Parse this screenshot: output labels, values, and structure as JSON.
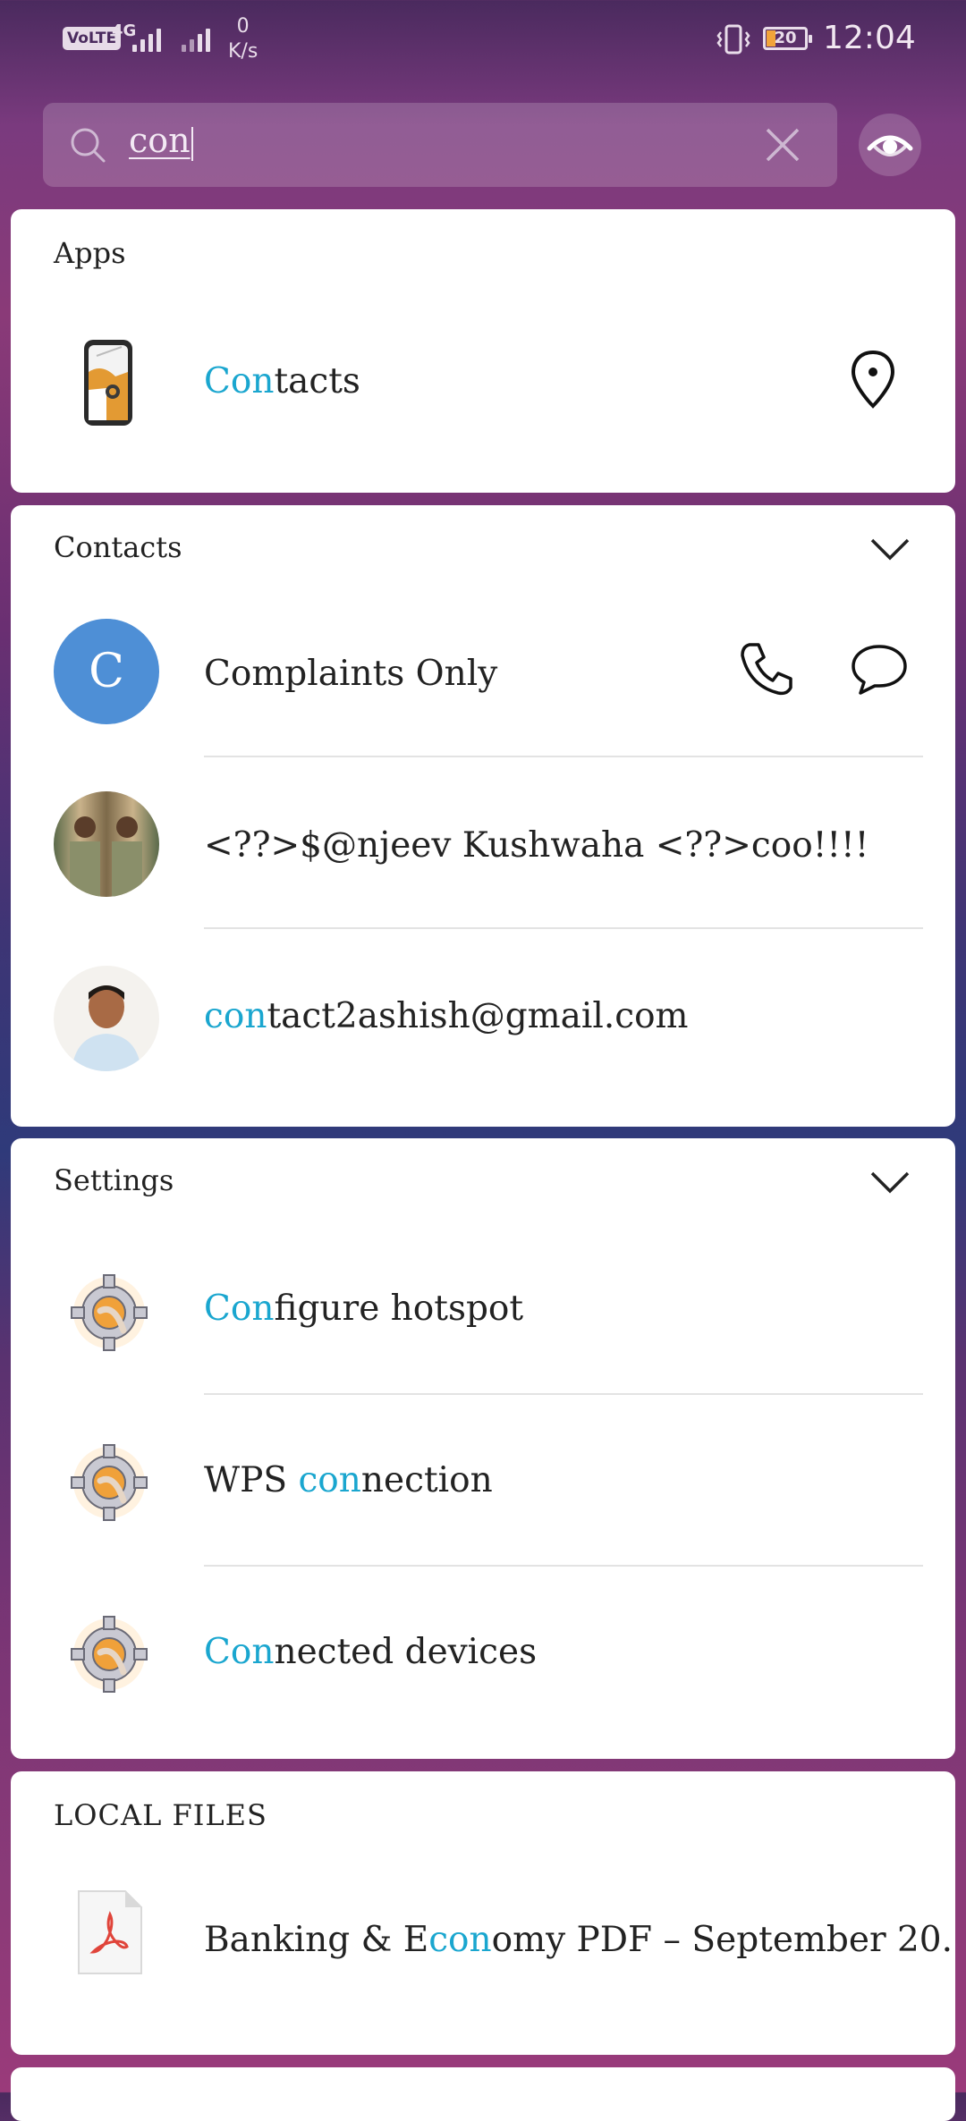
{
  "status_bar": {
    "volte": "VoLTE",
    "network": "4G",
    "speed_value": "0",
    "speed_unit": "K/s",
    "battery": "20",
    "time": "12:04"
  },
  "search": {
    "query": "con"
  },
  "apps": {
    "title": "Apps",
    "items": [
      {
        "label_pre": "",
        "label_hl": "Con",
        "label_post": "tacts"
      }
    ]
  },
  "contacts": {
    "title": "Contacts",
    "items": [
      {
        "avatar_letter": "C",
        "label_pre": "Complaints Only",
        "label_hl": "",
        "label_post": ""
      },
      {
        "avatar_letter": "",
        "label_pre": "<??>$@njeev Kushwaha <??>coo!!!!",
        "label_hl": "",
        "label_post": ""
      },
      {
        "avatar_letter": "",
        "label_pre": "",
        "label_hl": "con",
        "label_post": "tact2ashish@gmail.com"
      }
    ]
  },
  "settings": {
    "title": "Settings",
    "items": [
      {
        "label_pre": "",
        "label_hl": "Con",
        "label_post": "figure hotspot"
      },
      {
        "label_pre": "WPS ",
        "label_hl": "con",
        "label_post": "nection"
      },
      {
        "label_pre": "",
        "label_hl": "Con",
        "label_post": "nected devices"
      }
    ]
  },
  "local_files": {
    "title": "LOCAL FILES",
    "items": [
      {
        "label_pre": "Banking & E",
        "label_hl": "con",
        "label_post": "omy PDF – September 20..."
      }
    ]
  },
  "colors": {
    "highlight": "#1aa6cf",
    "avatar_blue": "#4e8fd6"
  }
}
